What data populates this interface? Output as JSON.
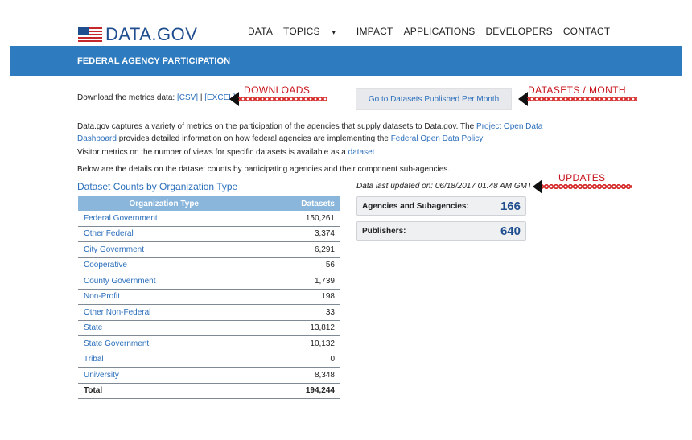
{
  "header": {
    "logo_text": "DATA.GOV",
    "nav": [
      "DATA",
      "TOPICS",
      "IMPACT",
      "APPLICATIONS",
      "DEVELOPERS",
      "CONTACT"
    ],
    "topics_caret": "▾"
  },
  "banner": {
    "title": "FEDERAL AGENCY PARTICIPATION"
  },
  "downloads": {
    "prefix": "Download the metrics data: ",
    "csv": "[CSV]",
    "sep": " | ",
    "excel": "[EXCEL]"
  },
  "goto_button": "Go to Datasets Published Per Month",
  "description": {
    "p1_a": "Data.gov captures a variety of metrics on the participation of the agencies that supply datasets to Data.gov. The ",
    "p1_link1": "Project Open Data Dashboard",
    "p1_b": " provides detailed information on how federal agencies are implementing the ",
    "p1_link2": "Federal Open Data Policy",
    "p2_a": "Visitor metrics on the number of views for specific datasets is available as a ",
    "p2_link": "dataset",
    "p3": "Below are the details on the dataset counts by participating agencies and their component sub-agencies."
  },
  "annotations": {
    "downloads": "DOWNLOADS",
    "datasets_month": "DATASETS / MONTH",
    "updates": "UPDATES"
  },
  "table": {
    "title": "Dataset Counts by Organization Type",
    "headers": {
      "org": "Organization Type",
      "count": "Datasets"
    },
    "rows": [
      {
        "org": "Federal Government",
        "count": "150,261"
      },
      {
        "org": "Other Federal",
        "count": "3,374"
      },
      {
        "org": "City Government",
        "count": "6,291"
      },
      {
        "org": "Cooperative",
        "count": "56"
      },
      {
        "org": "County Government",
        "count": "1,739"
      },
      {
        "org": "Non-Profit",
        "count": "198"
      },
      {
        "org": "Other Non-Federal",
        "count": "33"
      },
      {
        "org": "State",
        "count": "13,812"
      },
      {
        "org": "State Government",
        "count": "10,132"
      },
      {
        "org": "Tribal",
        "count": "0"
      },
      {
        "org": "University",
        "count": "8,348"
      }
    ],
    "total": {
      "label": "Total",
      "count": "194,244"
    }
  },
  "stats": {
    "updated": "Data last updated on: 06/18/2017 01:48 AM GMT",
    "agencies_label": "Agencies and Subagencies:",
    "agencies_value": "166",
    "publishers_label": "Publishers:",
    "publishers_value": "640"
  },
  "colors": {
    "banner": "#2e7bbf",
    "link": "#2a6ebb",
    "annotation": "#c8141c",
    "table_header": "#8ab6dc"
  }
}
